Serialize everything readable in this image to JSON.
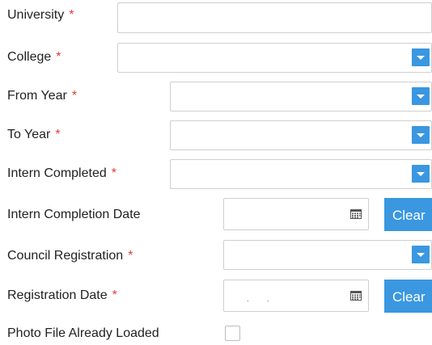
{
  "fields": {
    "university": {
      "label": "University",
      "required_mark": "*",
      "value": ""
    },
    "college": {
      "label": "College",
      "required_mark": "*",
      "value": ""
    },
    "from_year": {
      "label": "From Year",
      "required_mark": "*",
      "value": ""
    },
    "to_year": {
      "label": "To Year",
      "required_mark": "*",
      "value": ""
    },
    "intern_completed": {
      "label": "Intern Completed",
      "required_mark": "*",
      "value": ""
    },
    "intern_completion_date": {
      "label": "Intern Completion Date",
      "value": "",
      "clear_label": "Clear"
    },
    "council_registration": {
      "label": "Council Registration",
      "required_mark": "*",
      "value": ""
    },
    "registration_date": {
      "label": "Registration Date",
      "required_mark": "*",
      "value": ". .",
      "clear_label": "Clear"
    },
    "photo_file_loaded": {
      "label": "Photo File Already Loaded",
      "checked": false
    }
  },
  "icons": {
    "dropdown": "chevron-down-icon",
    "calendar": "calendar-icon"
  },
  "colors": {
    "accent": "#3a97e0",
    "required": "#e53935",
    "border": "#cfcfcf"
  }
}
